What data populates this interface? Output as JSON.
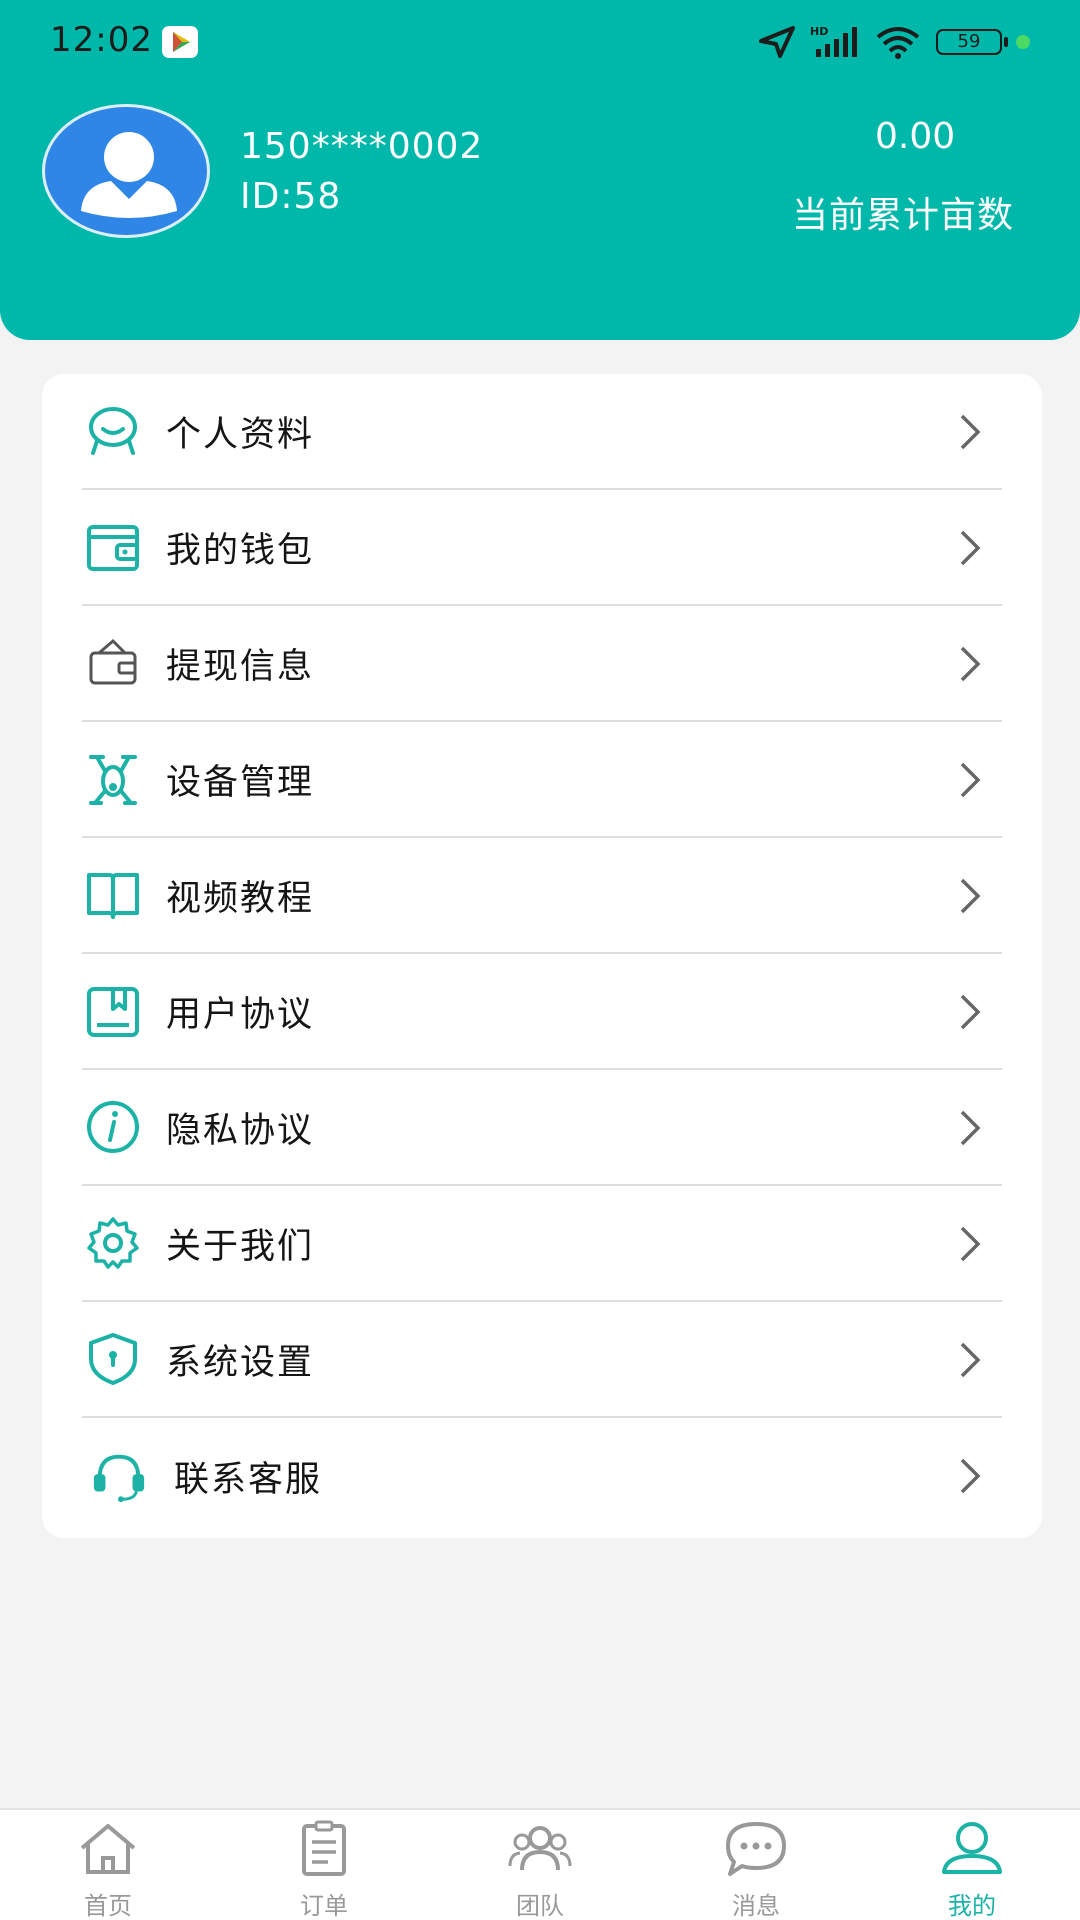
{
  "status_bar": {
    "time": "12:02",
    "battery": "59"
  },
  "profile": {
    "phone": "150****0002",
    "id_text": "ID:58",
    "acres_value": "0.00",
    "acres_label": "当前累计亩数"
  },
  "menu": {
    "items": [
      {
        "label": "个人资料",
        "icon": "smile-face-icon"
      },
      {
        "label": "我的钱包",
        "icon": "wallet-icon"
      },
      {
        "label": "提现信息",
        "icon": "cash-wallet-icon"
      },
      {
        "label": "设备管理",
        "icon": "drone-icon"
      },
      {
        "label": "视频教程",
        "icon": "book-icon"
      },
      {
        "label": "用户协议",
        "icon": "agreement-icon"
      },
      {
        "label": "隐私协议",
        "icon": "info-icon"
      },
      {
        "label": "关于我们",
        "icon": "gear-icon"
      },
      {
        "label": "系统设置",
        "icon": "shield-icon"
      },
      {
        "label": "联系客服",
        "icon": "headset-icon"
      }
    ]
  },
  "tabbar": {
    "tabs": [
      {
        "label": "首页",
        "icon": "home-icon"
      },
      {
        "label": "订单",
        "icon": "clipboard-icon"
      },
      {
        "label": "团队",
        "icon": "team-icon"
      },
      {
        "label": "消息",
        "icon": "chat-icon"
      },
      {
        "label": "我的",
        "icon": "user-icon"
      }
    ],
    "active_index": 4
  },
  "colors": {
    "accent": "#00b8a9",
    "icon": "#1cb3a6",
    "tab_inactive": "#999999"
  }
}
